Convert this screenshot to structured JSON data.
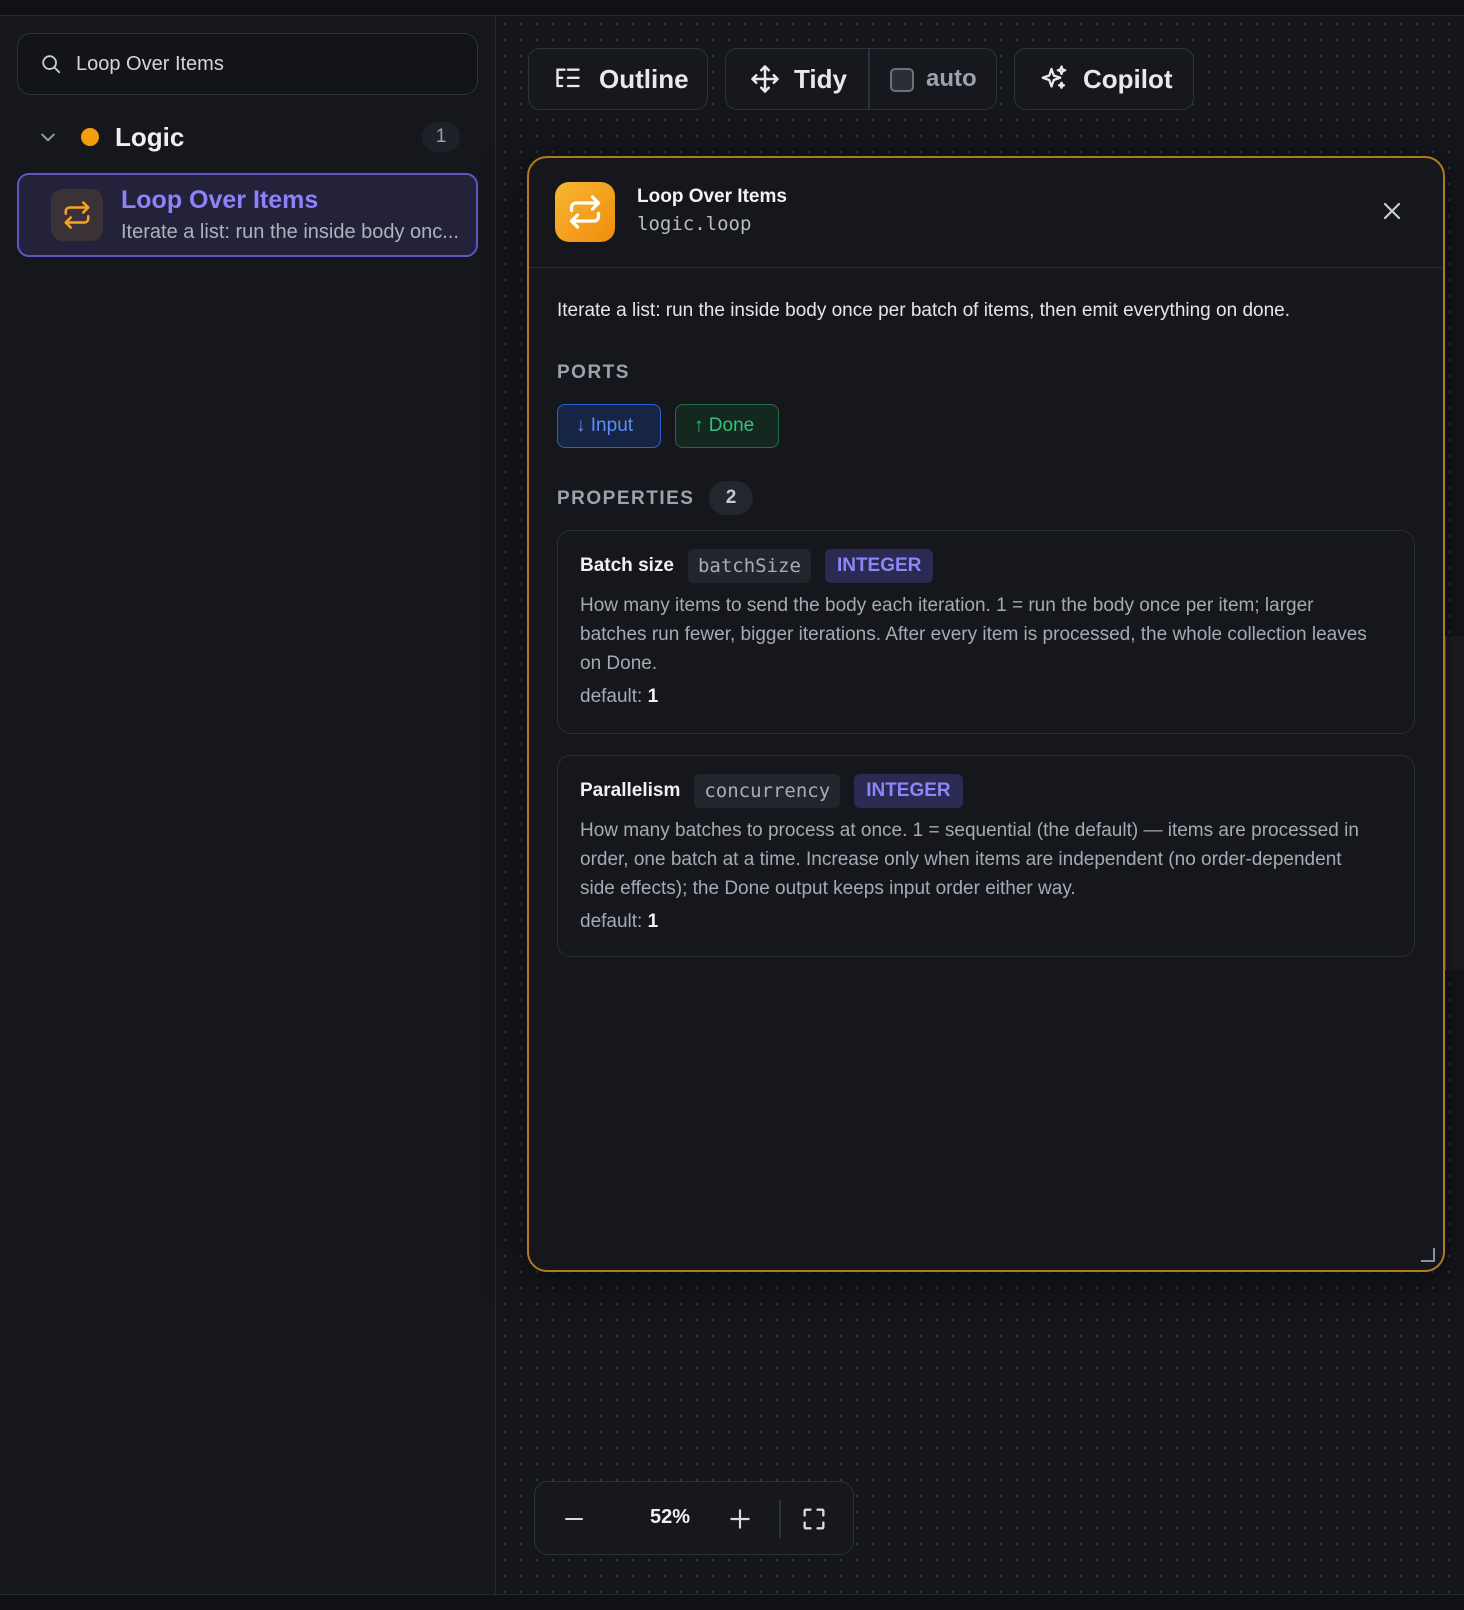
{
  "sidebar": {
    "search": {
      "value": "Loop Over Items"
    },
    "group": {
      "name": "Logic",
      "count": "1",
      "dot_color": "#f59e0b"
    },
    "node": {
      "title": "Loop Over Items",
      "description": "Iterate a list: run the inside body onc..."
    }
  },
  "toolbar": {
    "outline_label": "Outline",
    "tidy_label": "Tidy",
    "auto_label": "auto",
    "copilot_label": "Copilot"
  },
  "panel": {
    "title": "Loop Over Items",
    "id": "logic.loop",
    "description": "Iterate a list: run the inside body once per batch of items, then emit everything on done.",
    "ports_heading": "PORTS",
    "ports": [
      {
        "label": "↓ Input"
      },
      {
        "label": "↑ Done"
      }
    ],
    "properties_heading": "PROPERTIES",
    "properties_count": "2",
    "properties": [
      {
        "name": "Batch size",
        "key": "batchSize",
        "type": "INTEGER",
        "description": "How many items to send the body each iteration. 1 = run the body once per item; larger batches run fewer, bigger iterations. After every item is processed, the whole collection leaves on Done.",
        "default_label": "default:",
        "default_value": "1"
      },
      {
        "name": "Parallelism",
        "key": "concurrency",
        "type": "INTEGER",
        "description": "How many batches to process at once. 1 = sequential (the default) — items are processed in order, one batch at a time. Increase only when items are independent (no order-dependent side effects); the Done output keeps input order either way.",
        "default_label": "default:",
        "default_value": "1"
      }
    ],
    "accent_color": "#f59e0b"
  },
  "zoom": {
    "value": "52%"
  },
  "icons": [
    "search-icon",
    "chevron-down-icon",
    "loop-icon",
    "outline-icon",
    "move-icon",
    "sparkles-icon",
    "close-icon",
    "minus-icon",
    "plus-icon",
    "fullscreen-icon"
  ]
}
